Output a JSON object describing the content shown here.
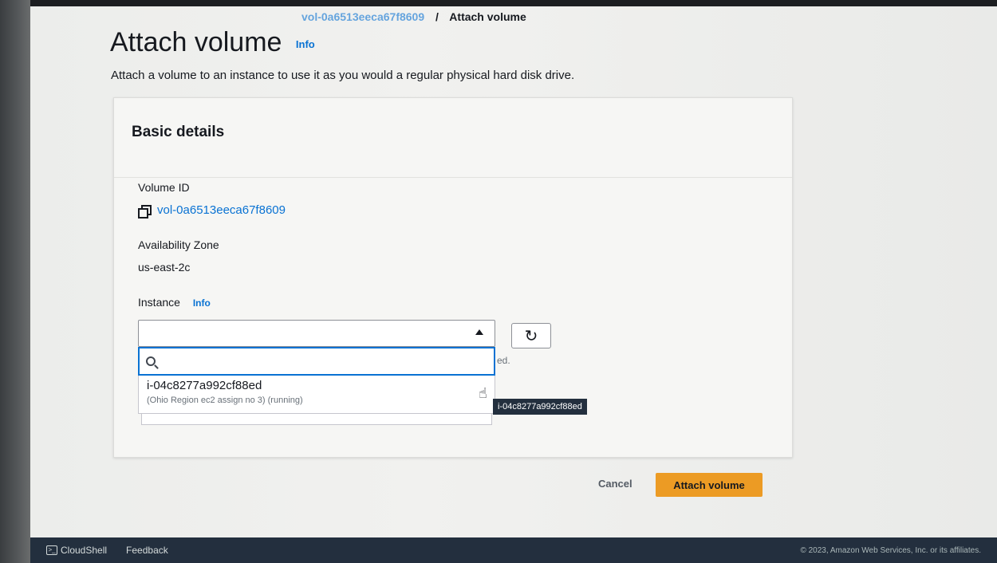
{
  "breadcrumb": {
    "parent": "vol-0a6513eeca67f8609",
    "separator": "/",
    "current": "Attach volume"
  },
  "page": {
    "title": "Attach volume",
    "info_label": "Info",
    "description": "Attach a volume to an instance to use it as you would a regular physical hard disk drive."
  },
  "panel": {
    "title": "Basic details",
    "volume_id_label": "Volume ID",
    "volume_id_value": "vol-0a6513eeca67f8609",
    "az_label": "Availability Zone",
    "az_value": "us-east-2c",
    "instance_label": "Instance",
    "instance_info": "Info",
    "instance_selected": "",
    "search_placeholder": "",
    "hint_fragment": "ed.",
    "options": [
      {
        "id": "i-04c8277a992cf88ed",
        "desc": "(Ohio Region ec2 assign no 3) (running)"
      }
    ],
    "tooltip": "i-04c8277a992cf88ed"
  },
  "actions": {
    "cancel_label": "Cancel",
    "attach_label": "Attach volume"
  },
  "footer": {
    "cloudshell_label": "CloudShell",
    "feedback_label": "Feedback",
    "copyright": "© 2023, Amazon Web Services, Inc. or its affiliates."
  }
}
